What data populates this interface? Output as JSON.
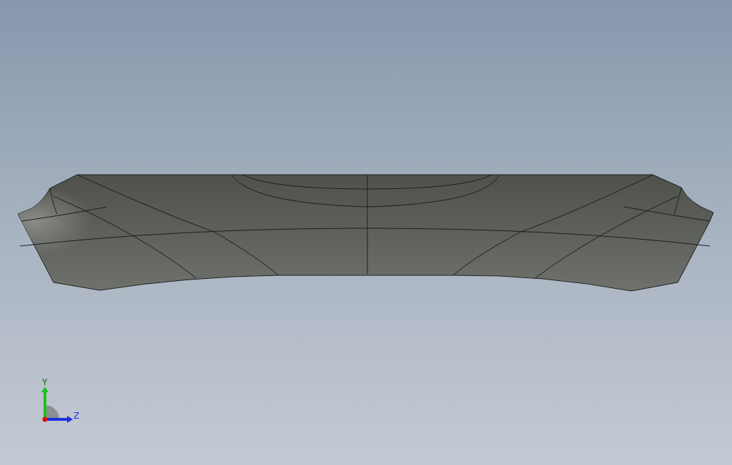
{
  "viewport": {
    "triad": [
      {
        "kind": "y",
        "label": "Y"
      },
      {
        "kind": "z",
        "label": "Z"
      }
    ]
  }
}
